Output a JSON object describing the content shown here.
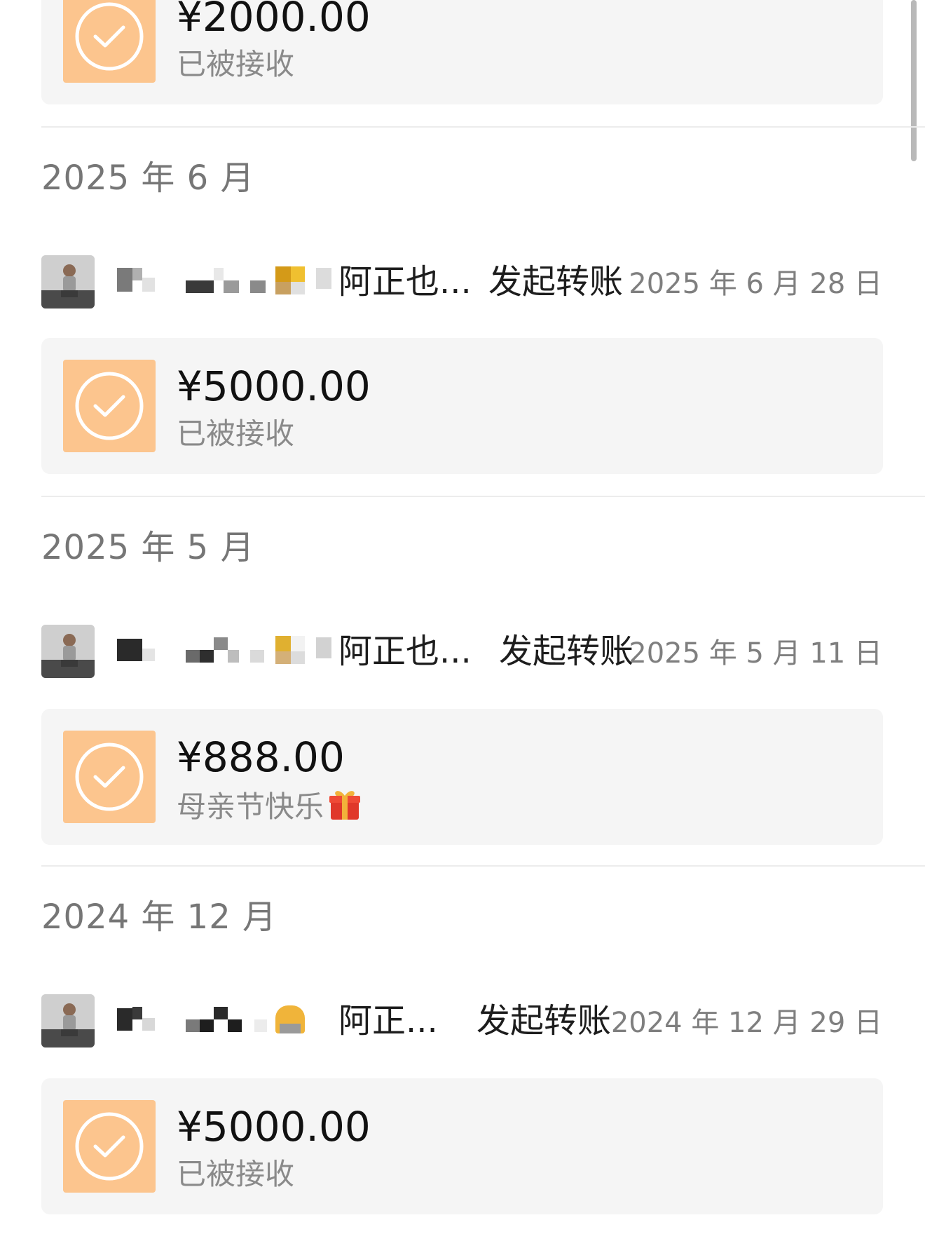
{
  "groups": [
    {
      "month": "",
      "transfers": [
        {
          "sender": "",
          "action": "",
          "date": "",
          "amount": "¥2000.00",
          "status": "已被接收"
        }
      ]
    },
    {
      "month": "2025 年 6 月",
      "transfers": [
        {
          "sender": "阿正也...",
          "action": "发起转账",
          "date": "2025 年 6 月 28 日",
          "amount": "¥5000.00",
          "status": "已被接收"
        }
      ]
    },
    {
      "month": "2025 年 5 月",
      "transfers": [
        {
          "sender": "阿正也...",
          "action": "发起转账",
          "date": "2025 年 5 月 11 日",
          "amount": "¥888.00",
          "status": "母亲节快乐"
        }
      ]
    },
    {
      "month": "2024 年 12 月",
      "transfers": [
        {
          "sender": "阿正...",
          "action": "发起转账",
          "date": "2024 年 12 月 29 日",
          "amount": "¥5000.00",
          "status": "已被接收"
        }
      ]
    }
  ],
  "icons": {
    "card_icon": "check-circle-icon",
    "gift": "gift-icon",
    "avatar": "avatar"
  },
  "colors": {
    "accent": "#fcc58e",
    "card_bg": "#f5f5f5",
    "muted_text": "#8a8a8a"
  }
}
